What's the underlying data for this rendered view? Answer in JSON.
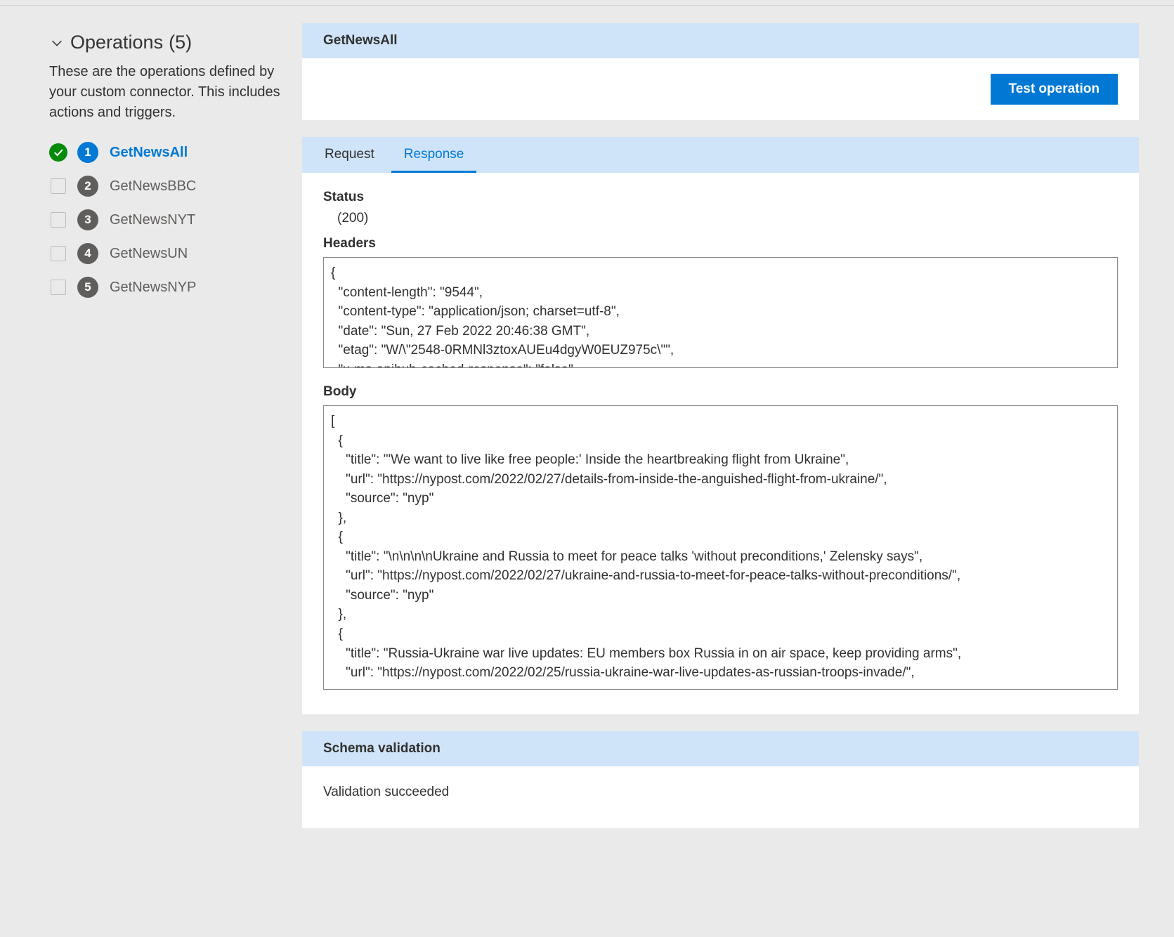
{
  "sidebar": {
    "header_label": "Operations",
    "header_count": "(5)",
    "description": "These are the operations defined by your custom connector. This includes actions and triggers.",
    "items": [
      {
        "num": "1",
        "label": "GetNewsAll",
        "active": true,
        "checked": true
      },
      {
        "num": "2",
        "label": "GetNewsBBC",
        "active": false,
        "checked": false
      },
      {
        "num": "3",
        "label": "GetNewsNYT",
        "active": false,
        "checked": false
      },
      {
        "num": "4",
        "label": "GetNewsUN",
        "active": false,
        "checked": false
      },
      {
        "num": "5",
        "label": "GetNewsNYP",
        "active": false,
        "checked": false
      }
    ]
  },
  "main": {
    "title": "GetNewsAll",
    "test_button": "Test operation",
    "tabs": {
      "request": "Request",
      "response": "Response",
      "active": "response"
    },
    "response": {
      "status_label": "Status",
      "status_value": "(200)",
      "headers_label": "Headers",
      "headers_text": "{\n  \"content-length\": \"9544\",\n  \"content-type\": \"application/json; charset=utf-8\",\n  \"date\": \"Sun, 27 Feb 2022 20:46:38 GMT\",\n  \"etag\": \"W/\\\"2548-0RMNl3ztoxAUEu4dgyW0EUZ975c\\\"\",\n  \"x-ms-apihub-cached-response\": \"false\",",
      "body_label": "Body",
      "body_text": "[\n  {\n    \"title\": \"'We want to live like free people:' Inside the heartbreaking flight from Ukraine\",\n    \"url\": \"https://nypost.com/2022/02/27/details-from-inside-the-anguished-flight-from-ukraine/\",\n    \"source\": \"nyp\"\n  },\n  {\n    \"title\": \"\\n\\n\\n\\nUkraine and Russia to meet for peace talks 'without preconditions,' Zelensky says\",\n    \"url\": \"https://nypost.com/2022/02/27/ukraine-and-russia-to-meet-for-peace-talks-without-preconditions/\",\n    \"source\": \"nyp\"\n  },\n  {\n    \"title\": \"Russia-Ukraine war live updates: EU members box Russia in on air space, keep providing arms\",\n    \"url\": \"https://nypost.com/2022/02/25/russia-ukraine-war-live-updates-as-russian-troops-invade/\","
    },
    "schema": {
      "title": "Schema validation",
      "message": "Validation succeeded"
    }
  }
}
